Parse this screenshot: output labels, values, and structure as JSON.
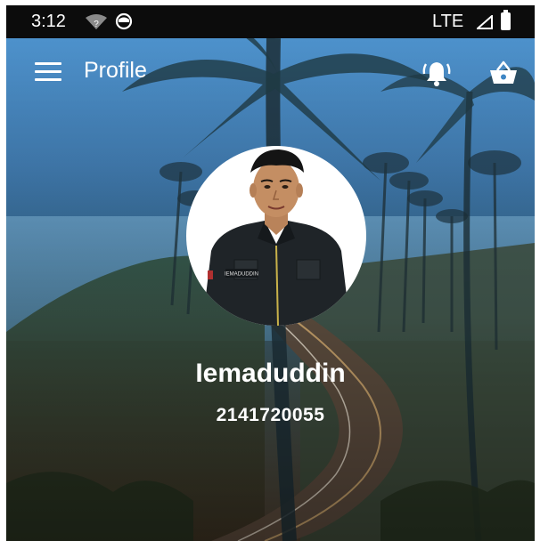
{
  "status_bar": {
    "time": "3:12",
    "network": "LTE",
    "icons": [
      "wifi-unknown-icon",
      "app-notification-icon",
      "signal-icon",
      "battery-icon"
    ]
  },
  "app_bar": {
    "title": "Profile",
    "menu_icon": "hamburger-menu-icon",
    "actions": [
      "bell-ring-icon",
      "basket-icon"
    ]
  },
  "profile": {
    "name": "Iemaduddin",
    "id": "2141720055",
    "badge_text": "IEMADUDDIN"
  },
  "colors": {
    "status_bar_bg": "#0c0c0c",
    "sky": "#4f94d2",
    "text": "#ffffff"
  }
}
